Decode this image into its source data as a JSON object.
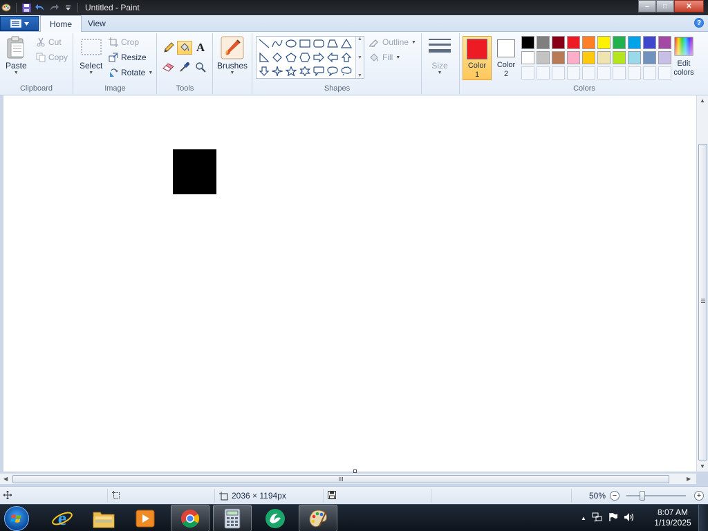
{
  "window": {
    "title": "Untitled - Paint",
    "controls": {
      "minimize": "–",
      "maximize": "□",
      "close": "✕"
    }
  },
  "tabs": [
    {
      "label": "Home",
      "active": true
    },
    {
      "label": "View",
      "active": false
    }
  ],
  "ribbon": {
    "clipboard": {
      "label": "Clipboard",
      "paste": "Paste",
      "cut": "Cut",
      "copy": "Copy"
    },
    "image": {
      "label": "Image",
      "select": "Select",
      "crop": "Crop",
      "resize": "Resize",
      "rotate": "Rotate"
    },
    "tools": {
      "label": "Tools",
      "text_glyph": "A"
    },
    "brushes": {
      "label": "Brushes"
    },
    "shapes": {
      "label": "Shapes",
      "outline": "Outline",
      "fill": "Fill"
    },
    "size": {
      "label": "Size"
    },
    "colors": {
      "label": "Colors",
      "color1": {
        "label": "Color",
        "index": "1",
        "value": "#ed1c24"
      },
      "color2": {
        "label": "Color",
        "index": "2",
        "value": "#ffffff"
      },
      "edit_colors": {
        "line1": "Edit",
        "line2": "colors"
      },
      "palette_row1": [
        "#000000",
        "#7f7f7f",
        "#880015",
        "#ed1c24",
        "#ff7f27",
        "#fff200",
        "#22b14c",
        "#00a2e8",
        "#3f48cc",
        "#a349a4"
      ],
      "palette_row2": [
        "#ffffff",
        "#c3c3c3",
        "#b97a57",
        "#ffaec9",
        "#ffc90e",
        "#efe4b0",
        "#b5e61d",
        "#99d9ea",
        "#7092be",
        "#c8bfe7"
      ]
    }
  },
  "status": {
    "image_size": "2036 × 1194px",
    "zoom": "50%"
  },
  "clock": {
    "time": "8:07 AM",
    "date": "1/19/2025"
  }
}
